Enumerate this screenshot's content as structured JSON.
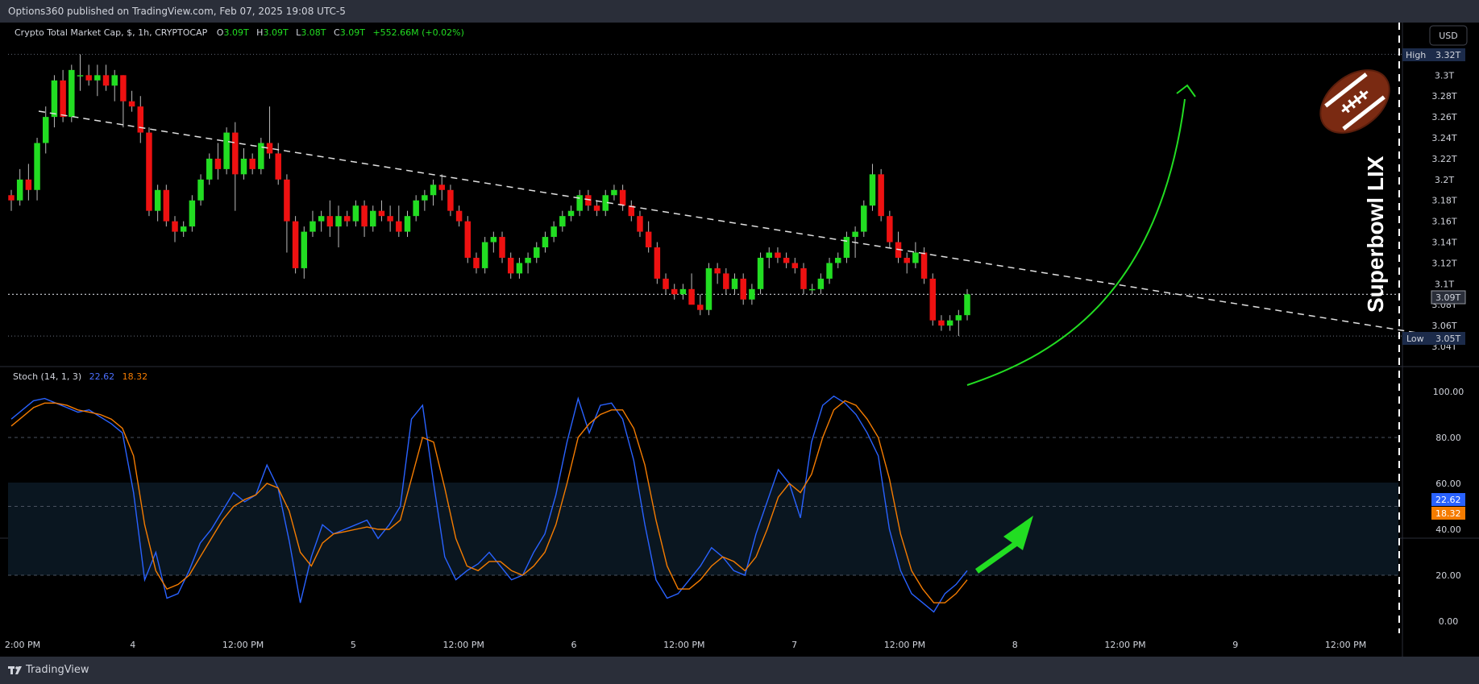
{
  "header": {
    "published_by": "Options360 published on TradingView.com, Feb 07, 2025 19:08 UTC-5"
  },
  "legend": {
    "symbol": "Crypto Total Market Cap, $, 1h, CRYPTOCAP",
    "o_label": "O",
    "o_value": "3.09T",
    "h_label": "H",
    "h_value": "3.09T",
    "l_label": "L",
    "l_value": "3.08T",
    "c_label": "C",
    "c_value": "3.09T",
    "change": "+552.66M (+0.02%)"
  },
  "currency_button": "USD",
  "annotation": {
    "vertical_text": "Superbowl LIX",
    "icon": "american-football-icon"
  },
  "price_axis": {
    "ticks": [
      "3.3T",
      "3.28T",
      "3.26T",
      "3.24T",
      "3.22T",
      "3.2T",
      "3.18T",
      "3.16T",
      "3.14T",
      "3.12T",
      "3.1T",
      "3.08T",
      "3.06T",
      "3.04T"
    ],
    "high_label": "High",
    "high_value": "3.32T",
    "low_label": "Low",
    "low_value": "3.05T",
    "current_value": "3.09T"
  },
  "stoch": {
    "title": "Stoch (14, 1, 3)",
    "k_value": "22.62",
    "d_value": "18.32",
    "ticks": [
      "100.00",
      "80.00",
      "60.00",
      "40.00",
      "20.00",
      "0.00"
    ],
    "k_badge": "22.62",
    "d_badge": "18.32"
  },
  "time_axis": [
    "2:00 PM",
    "4",
    "12:00 PM",
    "5",
    "12:00 PM",
    "6",
    "12:00 PM",
    "7",
    "12:00 PM",
    "8",
    "12:00 PM",
    "9",
    "12:00 PM"
  ],
  "footer": {
    "brand": "TradingView"
  },
  "colors": {
    "up": "#22dd22",
    "down": "#ee1111",
    "k_line": "#2962ff",
    "d_line": "#f57c00",
    "arrow": "#22dd22",
    "background": "#000000",
    "band": "#0a1620"
  },
  "chart_data": [
    {
      "type": "candlestick",
      "title": "Crypto Total Market Cap, $, 1h, CRYPTOCAP",
      "ylim": [
        3.03,
        3.335
      ],
      "high": 3.32,
      "low": 3.05,
      "last": 3.09,
      "ohlc": [
        [
          3.185,
          3.19,
          3.17,
          3.18
        ],
        [
          3.18,
          3.21,
          3.175,
          3.2
        ],
        [
          3.2,
          3.215,
          3.18,
          3.19
        ],
        [
          3.19,
          3.24,
          3.18,
          3.235
        ],
        [
          3.235,
          3.27,
          3.225,
          3.26
        ],
        [
          3.26,
          3.3,
          3.25,
          3.295
        ],
        [
          3.295,
          3.305,
          3.255,
          3.26
        ],
        [
          3.26,
          3.31,
          3.255,
          3.305
        ],
        [
          3.3,
          3.32,
          3.285,
          3.3
        ],
        [
          3.3,
          3.31,
          3.29,
          3.295
        ],
        [
          3.295,
          3.31,
          3.28,
          3.3
        ],
        [
          3.3,
          3.31,
          3.285,
          3.29
        ],
        [
          3.29,
          3.305,
          3.275,
          3.3
        ],
        [
          3.3,
          3.3,
          3.25,
          3.275
        ],
        [
          3.275,
          3.285,
          3.265,
          3.27
        ],
        [
          3.27,
          3.28,
          3.235,
          3.245
        ],
        [
          3.245,
          3.25,
          3.165,
          3.17
        ],
        [
          3.17,
          3.195,
          3.16,
          3.19
        ],
        [
          3.19,
          3.195,
          3.155,
          3.16
        ],
        [
          3.16,
          3.165,
          3.14,
          3.15
        ],
        [
          3.15,
          3.16,
          3.145,
          3.155
        ],
        [
          3.155,
          3.185,
          3.15,
          3.18
        ],
        [
          3.18,
          3.205,
          3.175,
          3.2
        ],
        [
          3.2,
          3.225,
          3.195,
          3.22
        ],
        [
          3.22,
          3.235,
          3.2,
          3.21
        ],
        [
          3.21,
          3.25,
          3.205,
          3.245
        ],
        [
          3.245,
          3.255,
          3.17,
          3.205
        ],
        [
          3.205,
          3.23,
          3.2,
          3.22
        ],
        [
          3.22,
          3.225,
          3.205,
          3.21
        ],
        [
          3.21,
          3.24,
          3.205,
          3.235
        ],
        [
          3.235,
          3.27,
          3.22,
          3.225
        ],
        [
          3.225,
          3.235,
          3.195,
          3.2
        ],
        [
          3.2,
          3.205,
          3.13,
          3.16
        ],
        [
          3.16,
          3.165,
          3.11,
          3.115
        ],
        [
          3.115,
          3.155,
          3.105,
          3.15
        ],
        [
          3.15,
          3.17,
          3.145,
          3.16
        ],
        [
          3.16,
          3.17,
          3.15,
          3.165
        ],
        [
          3.165,
          3.18,
          3.145,
          3.155
        ],
        [
          3.155,
          3.175,
          3.135,
          3.165
        ],
        [
          3.165,
          3.17,
          3.155,
          3.16
        ],
        [
          3.16,
          3.18,
          3.155,
          3.175
        ],
        [
          3.175,
          3.18,
          3.145,
          3.155
        ],
        [
          3.155,
          3.175,
          3.15,
          3.17
        ],
        [
          3.17,
          3.18,
          3.16,
          3.165
        ],
        [
          3.165,
          3.175,
          3.15,
          3.16
        ],
        [
          3.16,
          3.175,
          3.145,
          3.15
        ],
        [
          3.15,
          3.17,
          3.145,
          3.165
        ],
        [
          3.165,
          3.185,
          3.16,
          3.18
        ],
        [
          3.18,
          3.19,
          3.17,
          3.185
        ],
        [
          3.185,
          3.2,
          3.175,
          3.195
        ],
        [
          3.195,
          3.205,
          3.18,
          3.19
        ],
        [
          3.19,
          3.195,
          3.165,
          3.17
        ],
        [
          3.17,
          3.175,
          3.155,
          3.16
        ],
        [
          3.16,
          3.165,
          3.12,
          3.125
        ],
        [
          3.125,
          3.13,
          3.11,
          3.115
        ],
        [
          3.115,
          3.145,
          3.11,
          3.14
        ],
        [
          3.14,
          3.15,
          3.13,
          3.145
        ],
        [
          3.145,
          3.15,
          3.12,
          3.125
        ],
        [
          3.125,
          3.13,
          3.105,
          3.11
        ],
        [
          3.11,
          3.125,
          3.105,
          3.12
        ],
        [
          3.12,
          3.13,
          3.11,
          3.125
        ],
        [
          3.125,
          3.14,
          3.12,
          3.135
        ],
        [
          3.135,
          3.15,
          3.13,
          3.145
        ],
        [
          3.145,
          3.16,
          3.14,
          3.155
        ],
        [
          3.155,
          3.17,
          3.15,
          3.165
        ],
        [
          3.165,
          3.175,
          3.16,
          3.17
        ],
        [
          3.17,
          3.19,
          3.165,
          3.185
        ],
        [
          3.185,
          3.19,
          3.17,
          3.175
        ],
        [
          3.175,
          3.18,
          3.165,
          3.17
        ],
        [
          3.17,
          3.19,
          3.165,
          3.185
        ],
        [
          3.185,
          3.195,
          3.18,
          3.19
        ],
        [
          3.19,
          3.195,
          3.17,
          3.175
        ],
        [
          3.175,
          3.18,
          3.16,
          3.165
        ],
        [
          3.165,
          3.17,
          3.145,
          3.15
        ],
        [
          3.15,
          3.16,
          3.13,
          3.135
        ],
        [
          3.135,
          3.14,
          3.1,
          3.105
        ],
        [
          3.105,
          3.11,
          3.09,
          3.095
        ],
        [
          3.095,
          3.1,
          3.085,
          3.09
        ],
        [
          3.09,
          3.1,
          3.085,
          3.095
        ],
        [
          3.095,
          3.11,
          3.09,
          3.08
        ],
        [
          3.08,
          3.09,
          3.07,
          3.075
        ],
        [
          3.075,
          3.12,
          3.07,
          3.115
        ],
        [
          3.115,
          3.12,
          3.1,
          3.11
        ],
        [
          3.11,
          3.115,
          3.09,
          3.095
        ],
        [
          3.095,
          3.11,
          3.09,
          3.105
        ],
        [
          3.105,
          3.11,
          3.08,
          3.085
        ],
        [
          3.085,
          3.1,
          3.08,
          3.095
        ],
        [
          3.095,
          3.13,
          3.09,
          3.125
        ],
        [
          3.125,
          3.135,
          3.115,
          3.13
        ],
        [
          3.13,
          3.135,
          3.12,
          3.125
        ],
        [
          3.125,
          3.13,
          3.115,
          3.12
        ],
        [
          3.12,
          3.125,
          3.11,
          3.115
        ],
        [
          3.115,
          3.12,
          3.09,
          3.095
        ],
        [
          3.095,
          3.1,
          3.09,
          3.095
        ],
        [
          3.095,
          3.11,
          3.09,
          3.105
        ],
        [
          3.105,
          3.125,
          3.1,
          3.12
        ],
        [
          3.12,
          3.13,
          3.115,
          3.125
        ],
        [
          3.125,
          3.15,
          3.12,
          3.145
        ],
        [
          3.145,
          3.155,
          3.125,
          3.15
        ],
        [
          3.15,
          3.18,
          3.145,
          3.175
        ],
        [
          3.175,
          3.215,
          3.17,
          3.205
        ],
        [
          3.205,
          3.21,
          3.16,
          3.165
        ],
        [
          3.165,
          3.17,
          3.135,
          3.14
        ],
        [
          3.14,
          3.15,
          3.12,
          3.125
        ],
        [
          3.125,
          3.13,
          3.11,
          3.12
        ],
        [
          3.12,
          3.14,
          3.115,
          3.13
        ],
        [
          3.13,
          3.135,
          3.1,
          3.105
        ],
        [
          3.105,
          3.11,
          3.06,
          3.065
        ],
        [
          3.065,
          3.07,
          3.055,
          3.06
        ],
        [
          3.06,
          3.07,
          3.055,
          3.065
        ],
        [
          3.065,
          3.075,
          3.05,
          3.07
        ],
        [
          3.07,
          3.095,
          3.065,
          3.09
        ]
      ]
    },
    {
      "type": "line",
      "title": "Stoch (14, 1, 3)",
      "ylim": [
        0,
        100
      ],
      "series": [
        {
          "name": "K",
          "values": [
            88,
            92,
            96,
            97,
            95,
            93,
            91,
            92,
            89,
            86,
            82,
            56,
            18,
            30,
            10,
            12,
            22,
            34,
            40,
            48,
            56,
            52,
            55,
            68,
            58,
            35,
            8,
            28,
            42,
            38,
            40,
            42,
            44,
            36,
            42,
            50,
            88,
            94,
            60,
            28,
            18,
            22,
            25,
            30,
            24,
            18,
            20,
            30,
            38,
            55,
            78,
            97,
            82,
            94,
            95,
            88,
            70,
            42,
            18,
            10,
            12,
            18,
            24,
            32,
            28,
            22,
            20,
            38,
            52,
            66,
            60,
            45,
            78,
            94,
            98,
            95,
            90,
            82,
            72,
            40,
            22,
            12,
            8,
            4,
            12,
            16,
            22
          ]
        },
        {
          "name": "D",
          "values": [
            85,
            89,
            93,
            95,
            95,
            94,
            92,
            91,
            90,
            88,
            84,
            72,
            42,
            22,
            14,
            16,
            20,
            28,
            36,
            44,
            50,
            53,
            55,
            60,
            58,
            48,
            30,
            24,
            34,
            38,
            39,
            40,
            41,
            40,
            40,
            44,
            62,
            80,
            78,
            58,
            36,
            24,
            22,
            26,
            26,
            22,
            20,
            24,
            30,
            42,
            60,
            80,
            86,
            90,
            92,
            92,
            84,
            68,
            44,
            24,
            14,
            14,
            18,
            24,
            28,
            26,
            22,
            28,
            40,
            54,
            60,
            56,
            64,
            80,
            92,
            96,
            94,
            88,
            80,
            62,
            38,
            22,
            14,
            8,
            8,
            12,
            18
          ]
        }
      ]
    }
  ]
}
